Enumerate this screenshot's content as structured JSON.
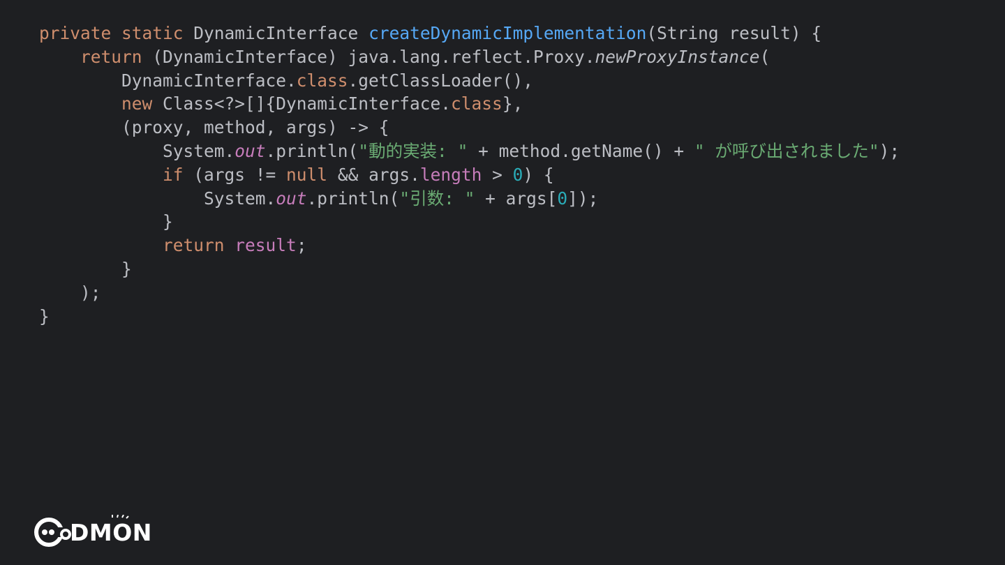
{
  "editor": {
    "theme": "dark",
    "background": "#1e1f22",
    "lines": [
      {
        "indent": 0,
        "tokens": [
          {
            "t": "private",
            "k": "kw"
          },
          {
            "t": " ",
            "k": "plain"
          },
          {
            "t": "static",
            "k": "kw"
          },
          {
            "t": " DynamicInterface ",
            "k": "plain"
          },
          {
            "t": "createDynamicImplementation",
            "k": "fn"
          },
          {
            "t": "(String result) {",
            "k": "plain"
          }
        ]
      },
      {
        "indent": 4,
        "tokens": [
          {
            "t": "return",
            "k": "kw"
          },
          {
            "t": " (DynamicInterface) java.lang.reflect.Proxy.",
            "k": "plain"
          },
          {
            "t": "newProxyInstance",
            "k": "it"
          },
          {
            "t": "(",
            "k": "plain"
          }
        ]
      },
      {
        "indent": 8,
        "tokens": [
          {
            "t": "DynamicInterface.",
            "k": "plain"
          },
          {
            "t": "class",
            "k": "kw"
          },
          {
            "t": ".getClassLoader(),",
            "k": "plain"
          }
        ]
      },
      {
        "indent": 8,
        "tokens": [
          {
            "t": "new",
            "k": "kw"
          },
          {
            "t": " Class<?>[]{DynamicInterface.",
            "k": "plain"
          },
          {
            "t": "class",
            "k": "kw"
          },
          {
            "t": "},",
            "k": "plain"
          }
        ]
      },
      {
        "indent": 8,
        "tokens": [
          {
            "t": "(proxy, method, args) -> {",
            "k": "plain"
          }
        ]
      },
      {
        "indent": 12,
        "tokens": [
          {
            "t": "System.",
            "k": "plain"
          },
          {
            "t": "out",
            "k": "static"
          },
          {
            "t": ".println(",
            "k": "plain"
          },
          {
            "t": "\"動的実装: \"",
            "k": "str"
          },
          {
            "t": " + method.getName() + ",
            "k": "plain"
          },
          {
            "t": "\" が呼び出されました\"",
            "k": "str"
          },
          {
            "t": ");",
            "k": "plain"
          }
        ]
      },
      {
        "indent": 12,
        "tokens": [
          {
            "t": "if",
            "k": "kw"
          },
          {
            "t": " (args != ",
            "k": "plain"
          },
          {
            "t": "null",
            "k": "kw"
          },
          {
            "t": " && args.",
            "k": "plain"
          },
          {
            "t": "length",
            "k": "field"
          },
          {
            "t": " > ",
            "k": "plain"
          },
          {
            "t": "0",
            "k": "num"
          },
          {
            "t": ") {",
            "k": "plain"
          }
        ]
      },
      {
        "indent": 16,
        "tokens": [
          {
            "t": "System.",
            "k": "plain"
          },
          {
            "t": "out",
            "k": "static"
          },
          {
            "t": ".println(",
            "k": "plain"
          },
          {
            "t": "\"引数: \"",
            "k": "str"
          },
          {
            "t": " + args[",
            "k": "plain"
          },
          {
            "t": "0",
            "k": "num"
          },
          {
            "t": "]);",
            "k": "plain"
          }
        ]
      },
      {
        "indent": 12,
        "tokens": [
          {
            "t": "}",
            "k": "plain"
          }
        ]
      },
      {
        "indent": 12,
        "tokens": [
          {
            "t": "return",
            "k": "kw"
          },
          {
            "t": " ",
            "k": "plain"
          },
          {
            "t": "result",
            "k": "field"
          },
          {
            "t": ";",
            "k": "plain"
          }
        ]
      },
      {
        "indent": 8,
        "tokens": [
          {
            "t": "}",
            "k": "plain"
          }
        ]
      },
      {
        "indent": 4,
        "tokens": [
          {
            "t": ");",
            "k": "plain"
          }
        ]
      },
      {
        "indent": 0,
        "tokens": [
          {
            "t": "}",
            "k": "plain"
          }
        ]
      }
    ],
    "colors": {
      "plain": "#bcbec4",
      "keyword": "#cf8e6d",
      "function": "#56a8f5",
      "string": "#6aab73",
      "number": "#2aacb8",
      "field": "#c77dbb"
    }
  },
  "logo": {
    "text": "DMON",
    "icon": "codmon-face-logo-icon",
    "color": "#ffffff"
  }
}
